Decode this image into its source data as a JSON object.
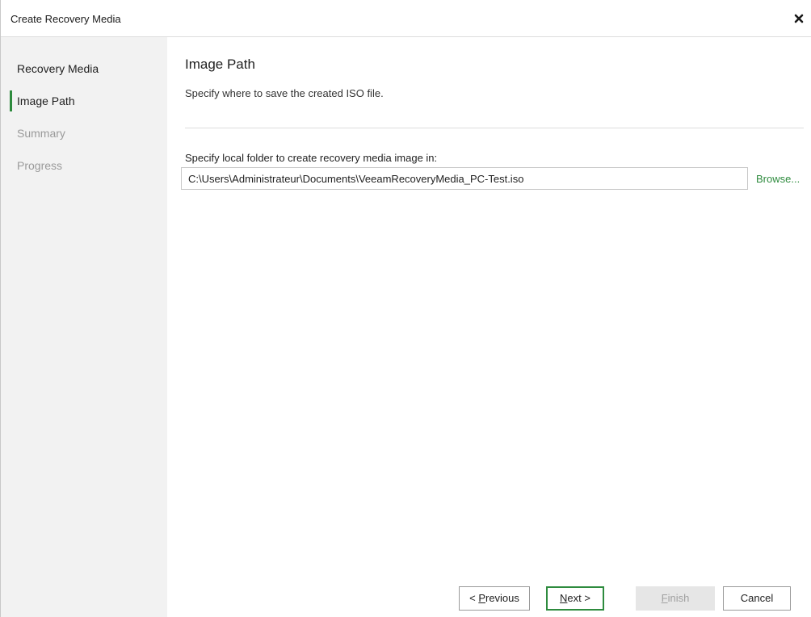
{
  "window": {
    "title": "Create Recovery Media",
    "close_icon": "close-icon"
  },
  "sidebar": {
    "items": [
      {
        "label": "Recovery Media",
        "state": "done"
      },
      {
        "label": "Image Path",
        "state": "active"
      },
      {
        "label": "Summary",
        "state": "future"
      },
      {
        "label": "Progress",
        "state": "future"
      }
    ]
  },
  "main": {
    "title": "Image Path",
    "subtitle": "Specify where to save the created ISO file.",
    "path_label": "Specify local folder to create recovery media image in:",
    "path_value": "C:\\Users\\Administrateur\\Documents\\VeeamRecoveryMedia_PC-Test.iso",
    "browse_label": "Browse..."
  },
  "footer": {
    "previous_prefix": "< ",
    "previous_mnemonic": "P",
    "previous_rest": "revious",
    "next_mnemonic": "N",
    "next_rest": "ext >",
    "finish_mnemonic": "F",
    "finish_rest": "inish",
    "cancel_label": "Cancel"
  },
  "colors": {
    "accent": "#2e8b3e",
    "sidebar_bg": "#f2f2f2",
    "disabled_bg": "#e6e6e6"
  }
}
